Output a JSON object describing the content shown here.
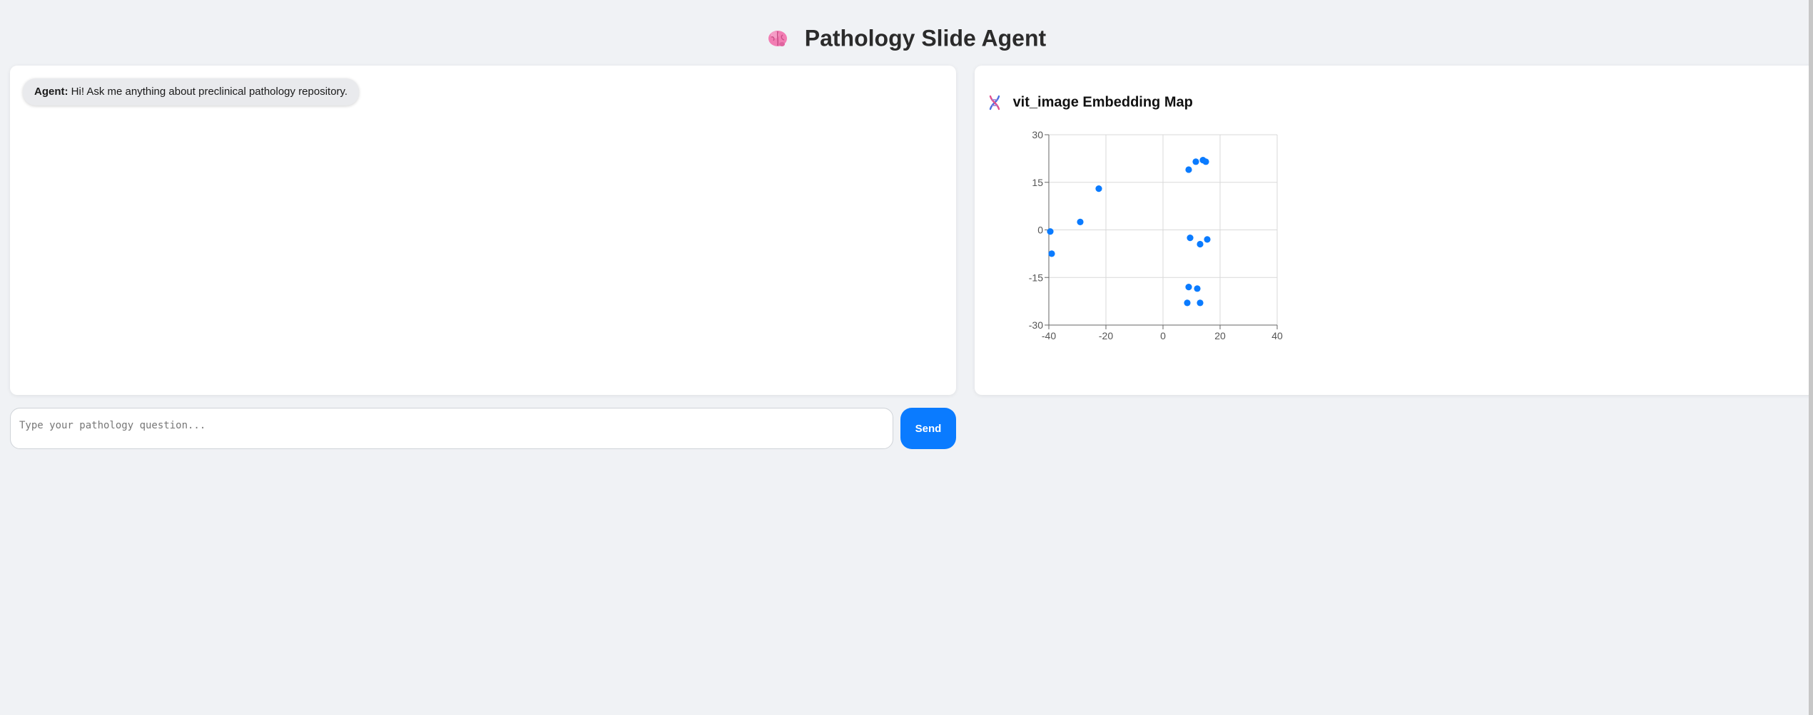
{
  "header": {
    "icon": "brain-icon",
    "title": "Pathology Slide Agent"
  },
  "chat": {
    "messages": [
      {
        "sender": "Agent:",
        "text": "Hi! Ask me anything about preclinical pathology repository."
      }
    ],
    "input_placeholder": "Type your pathology question...",
    "input_value": "",
    "send_label": "Send"
  },
  "embedding_map": {
    "icon": "dna-icon",
    "title": "vit_image Embedding Map"
  },
  "chart_data": {
    "type": "scatter",
    "title": "",
    "xlabel": "",
    "ylabel": "",
    "xlim": [
      -40,
      40
    ],
    "ylim": [
      -30,
      30
    ],
    "x_ticks": [
      "-40",
      "-20",
      "0",
      "20",
      "40"
    ],
    "y_ticks": [
      "30",
      "15",
      "0",
      "-15",
      "-30"
    ],
    "grid": true,
    "marker_color": "#0a7bff",
    "points": [
      {
        "x": -39.5,
        "y": -0.5
      },
      {
        "x": -39,
        "y": -7.5
      },
      {
        "x": -29,
        "y": 2.5
      },
      {
        "x": -22.5,
        "y": 13
      },
      {
        "x": 9,
        "y": 19
      },
      {
        "x": 11.5,
        "y": 21.5
      },
      {
        "x": 14,
        "y": 22
      },
      {
        "x": 15,
        "y": 21.5
      },
      {
        "x": 9.5,
        "y": -2.5
      },
      {
        "x": 13,
        "y": -4.5
      },
      {
        "x": 15.5,
        "y": -3
      },
      {
        "x": 9,
        "y": -18
      },
      {
        "x": 12,
        "y": -18.5
      },
      {
        "x": 8.5,
        "y": -23
      },
      {
        "x": 13,
        "y": -23
      }
    ]
  },
  "colors": {
    "accent": "#0a7bff",
    "background": "#f0f2f5",
    "panel": "#ffffff",
    "bubble": "#e9eaed"
  }
}
